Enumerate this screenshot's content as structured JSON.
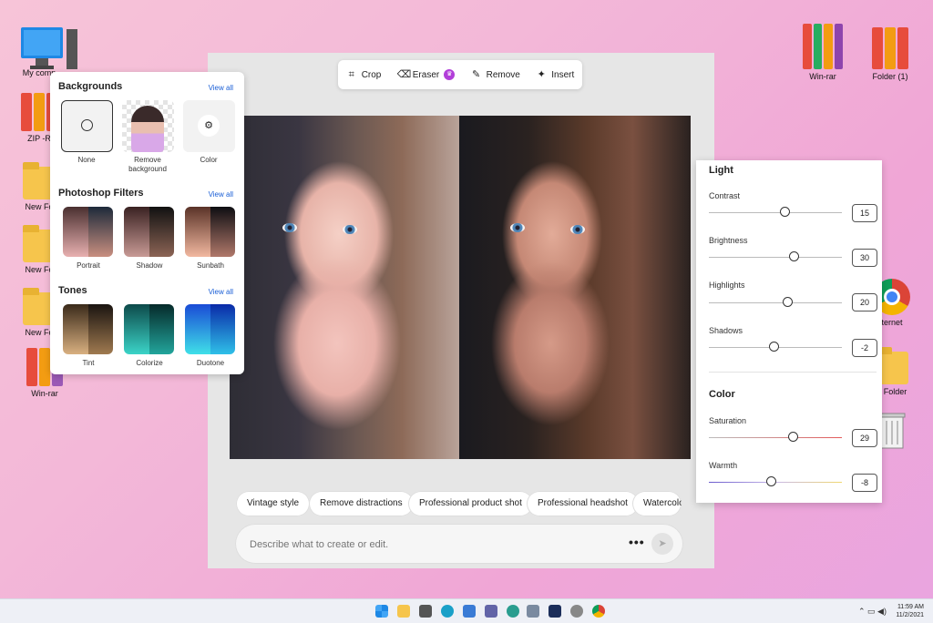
{
  "desktop": {
    "left_icons": [
      "My comp",
      "ZIP -R",
      "New Fo",
      "New Fo",
      "New Fo",
      "Win-rar"
    ],
    "right_icons": [
      "Win-rar",
      "Folder (1)",
      "ternet",
      "v Folder"
    ]
  },
  "toolbar": {
    "crop": "Crop",
    "eraser": "Eraser",
    "remove": "Remove",
    "insert": "Insert"
  },
  "left_panel": {
    "backgrounds": {
      "title": "Backgrounds",
      "view_all": "View all",
      "items": [
        "None",
        "Remove background",
        "Color"
      ]
    },
    "filters": {
      "title": "Photoshop Filters",
      "view_all": "View all",
      "items": [
        "Portrait",
        "Shadow",
        "Sunbath"
      ]
    },
    "tones": {
      "title": "Tones",
      "view_all": "View all",
      "items": [
        "Tint",
        "Colorize",
        "Duotone"
      ]
    }
  },
  "right_panel": {
    "light_title": "Light",
    "color_title": "Color",
    "light": [
      {
        "label": "Contrast",
        "value": "15"
      },
      {
        "label": "Brightness",
        "value": "30"
      },
      {
        "label": "Highlights",
        "value": "20"
      },
      {
        "label": "Shadows",
        "value": "-2"
      }
    ],
    "color": [
      {
        "label": "Saturation",
        "value": "29"
      },
      {
        "label": "Warmth",
        "value": "-8"
      }
    ]
  },
  "suggestions": [
    "Vintage style",
    "Remove distractions",
    "Professional product shot",
    "Professional headshot",
    "Watercolor"
  ],
  "prompt": {
    "placeholder": "Describe what to create or edit.",
    "more": "•••"
  },
  "clock": {
    "time": "11:59 AM",
    "date": "11/2/2021"
  },
  "colors": {
    "accent": "#1a5fd6",
    "premium": "#b23fd9"
  }
}
